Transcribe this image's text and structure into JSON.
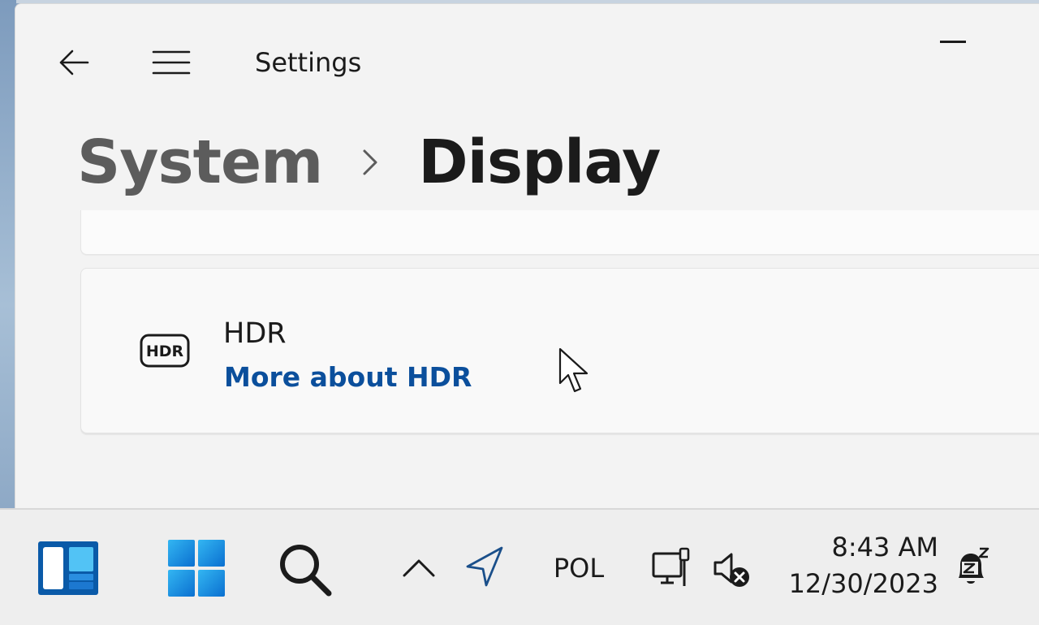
{
  "window": {
    "app_title": "Settings"
  },
  "breadcrumb": {
    "parent": "System",
    "current": "Display"
  },
  "hdr_card": {
    "title": "HDR",
    "link": "More about HDR",
    "icon_text": "HDR"
  },
  "taskbar": {
    "language": "POL",
    "time": "8:43 AM",
    "date": "12/30/2023"
  },
  "colors": {
    "accent_link": "#0b4f9c",
    "window_bg": "#f3f3f3",
    "taskbar_bg": "#eeeeee",
    "windows_logo": "#1e90e0"
  },
  "icons": {
    "back": "back-arrow-icon",
    "menu": "hamburger-menu-icon",
    "separator": "chevron-right-icon",
    "hdr": "hdr-icon",
    "widgets": "widgets-icon",
    "start": "windows-logo-icon",
    "search": "search-icon",
    "tray": "chevron-up-icon",
    "location": "location-arrow-icon",
    "network": "network-ethernet-icon",
    "volume": "volume-muted-icon",
    "notifications": "notification-bell-dnd-icon"
  }
}
